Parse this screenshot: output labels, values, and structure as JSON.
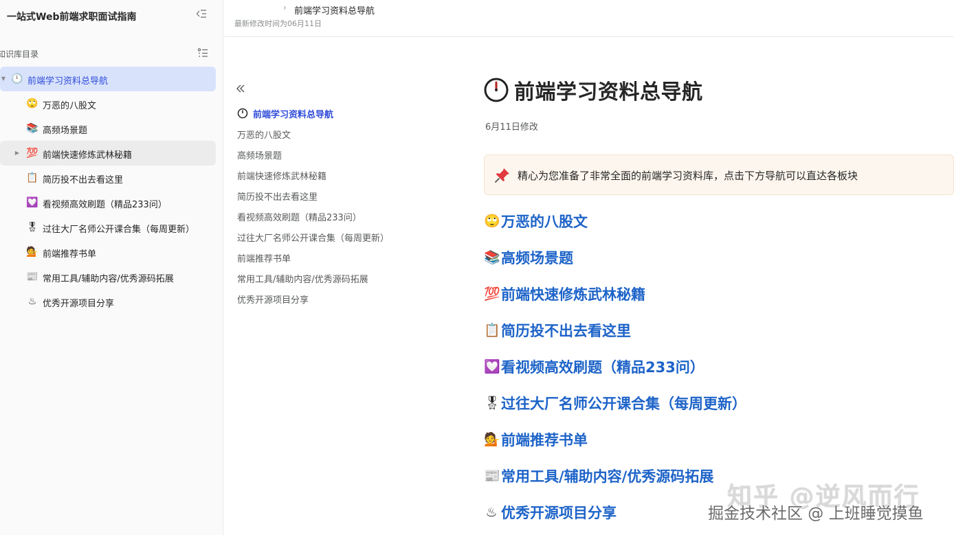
{
  "sidebar": {
    "title": "一站式Web前端求职面试指南",
    "section_label": "知识库目录",
    "items": [
      {
        "label": "前端学习资料总导航",
        "icon": "clock-icon",
        "emoji": "🕛",
        "active": true,
        "expandable": true,
        "expanded": true
      },
      {
        "label": "万恶的八股文",
        "icon": "smirk-face-icon",
        "emoji": "🙄",
        "active": false,
        "expandable": false
      },
      {
        "label": "高频场景题",
        "icon": "books-icon",
        "emoji": "📚",
        "active": false,
        "expandable": false
      },
      {
        "label": "前端快速修炼武林秘籍",
        "icon": "hundred-points-icon",
        "emoji": "💯",
        "active": false,
        "expandable": true,
        "expanded": false,
        "hover": true
      },
      {
        "label": "简历投不出去看这里",
        "icon": "clipboard-icon",
        "emoji": "📋",
        "active": false,
        "expandable": false
      },
      {
        "label": "看视频高效刷题（精品233问）",
        "icon": "heart-box-icon",
        "emoji": "💟",
        "active": false,
        "expandable": false
      },
      {
        "label": "过往大厂名师公开课合集（每周更新）",
        "icon": "medal-icon",
        "emoji": "🎖",
        "active": false,
        "expandable": false
      },
      {
        "label": "前端推荐书单",
        "icon": "person-reading-icon",
        "emoji": "💁",
        "active": false,
        "expandable": false
      },
      {
        "label": "常用工具/辅助内容/优秀源码拓展",
        "icon": "newspaper-icon",
        "emoji": "📰",
        "active": false,
        "expandable": false
      },
      {
        "label": "优秀开源项目分享",
        "icon": "hot-springs-icon",
        "emoji": "♨",
        "active": false,
        "expandable": false
      }
    ]
  },
  "topbar": {
    "breadcrumb_current": "前端学习资料总导航",
    "modified": "最新修改时间为06月11日"
  },
  "toc": {
    "items": [
      {
        "label": "前端学习资料总导航",
        "active": true
      },
      {
        "label": "万恶的八股文",
        "active": false
      },
      {
        "label": "高频场景题",
        "active": false
      },
      {
        "label": "前端快速修炼武林秘籍",
        "active": false
      },
      {
        "label": "简历投不出去看这里",
        "active": false
      },
      {
        "label": "看视频高效刷题（精品233问）",
        "active": false
      },
      {
        "label": "过往大厂名师公开课合集（每周更新）",
        "active": false
      },
      {
        "label": "前端推荐书单",
        "active": false
      },
      {
        "label": "常用工具/辅助内容/优秀源码拓展",
        "active": false
      },
      {
        "label": "优秀开源项目分享",
        "active": false
      }
    ]
  },
  "doc": {
    "title": "前端学习资料总导航",
    "date": "6月11日修改",
    "callout": "精心为您准备了非常全面的前端学习资料库，点击下方导航可以直达各板块",
    "links": [
      {
        "label": "万恶的八股文",
        "icon": "smirk-face-icon",
        "emoji": "🙄"
      },
      {
        "label": "高频场景题",
        "icon": "books-icon",
        "emoji": "📚"
      },
      {
        "label": "前端快速修炼武林秘籍",
        "icon": "hundred-points-icon",
        "emoji": "💯"
      },
      {
        "label": "简历投不出去看这里",
        "icon": "clipboard-icon",
        "emoji": "📋"
      },
      {
        "label": "看视频高效刷题（精品233问）",
        "icon": "heart-box-icon",
        "emoji": "💟"
      },
      {
        "label": "过往大厂名师公开课合集（每周更新）",
        "icon": "medal-icon",
        "emoji": "🎖"
      },
      {
        "label": "前端推荐书单",
        "icon": "person-reading-icon",
        "emoji": "💁"
      },
      {
        "label": "常用工具/辅助内容/优秀源码拓展",
        "icon": "newspaper-icon",
        "emoji": "📰"
      },
      {
        "label": "优秀开源项目分享",
        "icon": "hot-springs-icon",
        "emoji": "♨"
      }
    ]
  },
  "watermark": {
    "zhihu": "知乎 @逆风而行",
    "juejin": "掘金技术社区 @ 上班睡觉摸鱼"
  },
  "colors": {
    "accent": "#2f4bda",
    "link": "#1d63c8",
    "active_bg": "#d8e3fb",
    "callout_bg": "#fdf6ee"
  }
}
